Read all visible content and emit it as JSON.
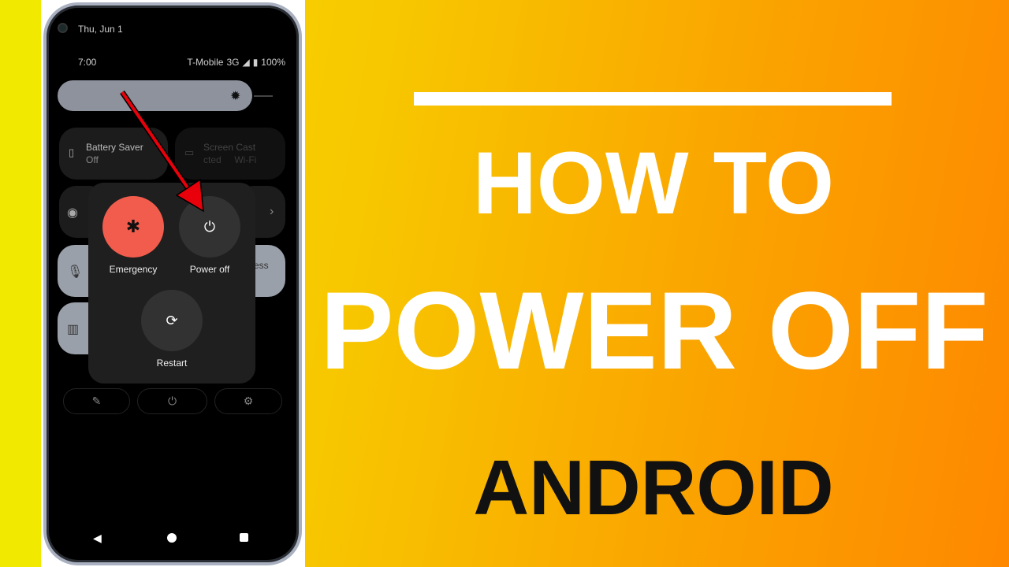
{
  "phone": {
    "date": "Thu, Jun 1",
    "time": "7:00",
    "carrier": "T-Mobile",
    "network": "3G",
    "battery": "100%",
    "tiles": [
      {
        "title": "Battery Saver",
        "subtitle": "Off"
      },
      {
        "title": "Screen Cast",
        "subtitle": "cted     Wi-Fi"
      }
    ],
    "tile_fragment": "ess",
    "power_menu": {
      "emergency": "Emergency",
      "power_off": "Power off",
      "restart": "Restart"
    },
    "colors": {
      "emergency": "#f25c4c",
      "arrow": "#e8000b"
    }
  },
  "headline": {
    "line1": "HOW TO",
    "line2": "POWER OFF",
    "line3": "ANDROID"
  }
}
